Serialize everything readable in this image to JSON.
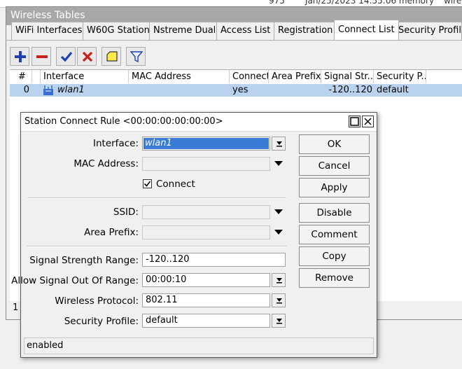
{
  "background": {
    "log_snippet_1": "975",
    "log_snippet_2": "Jan/25/2023 14:55:06 memory",
    "log_snippet_3": "wire"
  },
  "main_window": {
    "title": "Wireless Tables",
    "tabs": [
      {
        "label": "WiFi Interfaces"
      },
      {
        "label": "W60G Station"
      },
      {
        "label": "Nstreme Dual"
      },
      {
        "label": "Access List"
      },
      {
        "label": "Registration"
      },
      {
        "label": "Connect List",
        "active": true
      },
      {
        "label": "Security Profiles"
      }
    ],
    "toolbar": [
      "add-icon",
      "remove-icon",
      "enable-icon",
      "disable-icon",
      "comment-icon",
      "filter-icon"
    ],
    "columns": [
      "#",
      "Interface",
      "MAC Address",
      "Connect",
      "Area Prefix",
      "Signal Str...",
      "Security P..."
    ],
    "rows": [
      {
        "num": "0",
        "interface": "wlan1",
        "mac": "",
        "connect": "yes",
        "area_prefix": "",
        "signal": "-120..120",
        "security": "default"
      }
    ],
    "item_count": "1"
  },
  "dialog": {
    "title": "Station Connect Rule <00:00:00:00:00:00>",
    "fields": {
      "interface_label": "Interface:",
      "interface_value": "wlan1",
      "mac_label": "MAC Address:",
      "mac_value": "",
      "connect_label": "Connect",
      "connect_checked": true,
      "ssid_label": "SSID:",
      "ssid_value": "",
      "area_prefix_label": "Area Prefix:",
      "area_prefix_value": "",
      "signal_label": "Signal Strength Range:",
      "signal_value": "-120..120",
      "allow_signal_label": "Allow Signal Out Of Range:",
      "allow_signal_value": "00:00:10",
      "protocol_label": "Wireless Protocol:",
      "protocol_value": "802.11",
      "security_label": "Security Profile:",
      "security_value": "default"
    },
    "buttons": {
      "ok": "OK",
      "cancel": "Cancel",
      "apply": "Apply",
      "disable": "Disable",
      "comment": "Comment",
      "copy": "Copy",
      "remove": "Remove"
    },
    "status": "enabled"
  },
  "colors": {
    "selected_row": "#b9d3ee",
    "input_highlight": "#3a7bd5",
    "title_bar_inactive": "#a8a8a8"
  }
}
